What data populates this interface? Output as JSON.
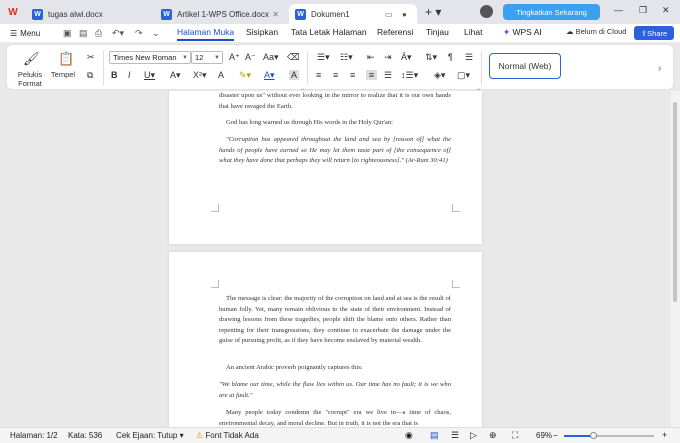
{
  "tabs": [
    {
      "label": "tugas alwi.docx"
    },
    {
      "label": "Artikel 1-WPS Office.docx"
    },
    {
      "label": "Dokumen1"
    }
  ],
  "header": {
    "upgrade_label": "Tingkatkan Sekarang"
  },
  "menubar": {
    "menu_label": "Menu",
    "tabs": [
      "Halaman Muka",
      "Sisipkan",
      "Tata Letak Halaman",
      "Referensi",
      "Tinjau",
      "Lihat",
      "WPS AI"
    ],
    "cloud_label": "Belum di Cloud",
    "share_label": "Share"
  },
  "ribbon": {
    "format_painter_label": "Pelukis Format",
    "paste_label": "Tempel",
    "font_name": "Times New Roman",
    "font_size": "12",
    "style_name": "Normal (Web)"
  },
  "document": {
    "page1": [
      "disaster upon us\" without ever looking in the mirror to realize that it is our own hands that have ravaged the Earth.",
      "God has long warned us through His words in the Holy Qur'an:",
      "\"Corruption has appeared throughout the land and sea by [reason of] what the hands of people have earned so He may let them taste part of [the consequence of] what they have done that perhaps they will return [to righteousness].\" (Ar-Rum 30:41)"
    ],
    "page2": [
      "The message is clear: the majority of the corruption on land and at sea is the result of human folly. Yet, many remain oblivious to the state of their environment. Instead of drawing lessons from these tragedies, people shift the blame onto others. Rather than repenting for their transgressions, they continue to exacerbate the damage under the guise of pursuing profit, as if they have become enslaved by material wealth.",
      "An ancient Arabic proverb poignantly captures this:",
      "\"We blame our time, while the flaw lies within us. Our time has no fault; it is we who are at fault.\"",
      "Many people today condemn the \"corrupt\" era we live in—a time of chaos, environmental decay, and moral decline. But in truth, it is not the era that is"
    ]
  },
  "statusbar": {
    "page": "Halaman: 1/2",
    "words": "Kata: 536",
    "spell": "Cek Ejaan: Tutup",
    "font_missing": "Font Tidak Ada",
    "zoom": "69%"
  },
  "zoom_level": 0.69,
  "colors": {
    "accent": "#2b62d9",
    "upgrade": "#3aa0ef",
    "wps_logo": "#e0301e"
  }
}
